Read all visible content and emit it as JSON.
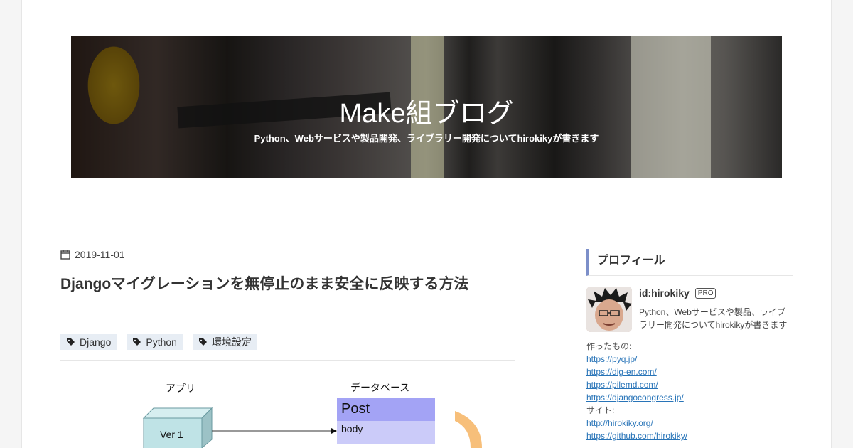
{
  "header": {
    "title": "Make組ブログ",
    "subtitle": "Python、Webサービスや製品開発、ライブラリー開発についてhirokikyが書きます"
  },
  "post": {
    "date": "2019-11-01",
    "title": "Djangoマイグレーションを無停止のまま安全に反映する方法",
    "tags": [
      "Django",
      "Python",
      "環境設定"
    ]
  },
  "diagram": {
    "app_label": "アプリ",
    "db_label": "データベース",
    "box_label": "Ver 1",
    "table_name": "Post",
    "table_field": "body"
  },
  "sidebar": {
    "heading": "プロフィール",
    "user_id": "id:hirokiky",
    "badge": "PRO",
    "description": "Python、Webサービスや製品、ライブラリー開発についてhirokikyが書きます",
    "made_label": "作ったもの:",
    "made_links": [
      "https://pyq.jp/",
      "https://dig-en.com/",
      "https://pilemd.com/",
      "https://djangocongress.jp/"
    ],
    "site_label": "サイト:",
    "site_links": [
      "http://hirokiky.org/",
      "https://github.com/hirokiky/"
    ]
  },
  "colors": {
    "accent": "#7c8fc9",
    "link": "#2874b8",
    "tag_bg": "#e7edf4"
  },
  "icons": [
    "calendar-icon",
    "tag-icon"
  ]
}
